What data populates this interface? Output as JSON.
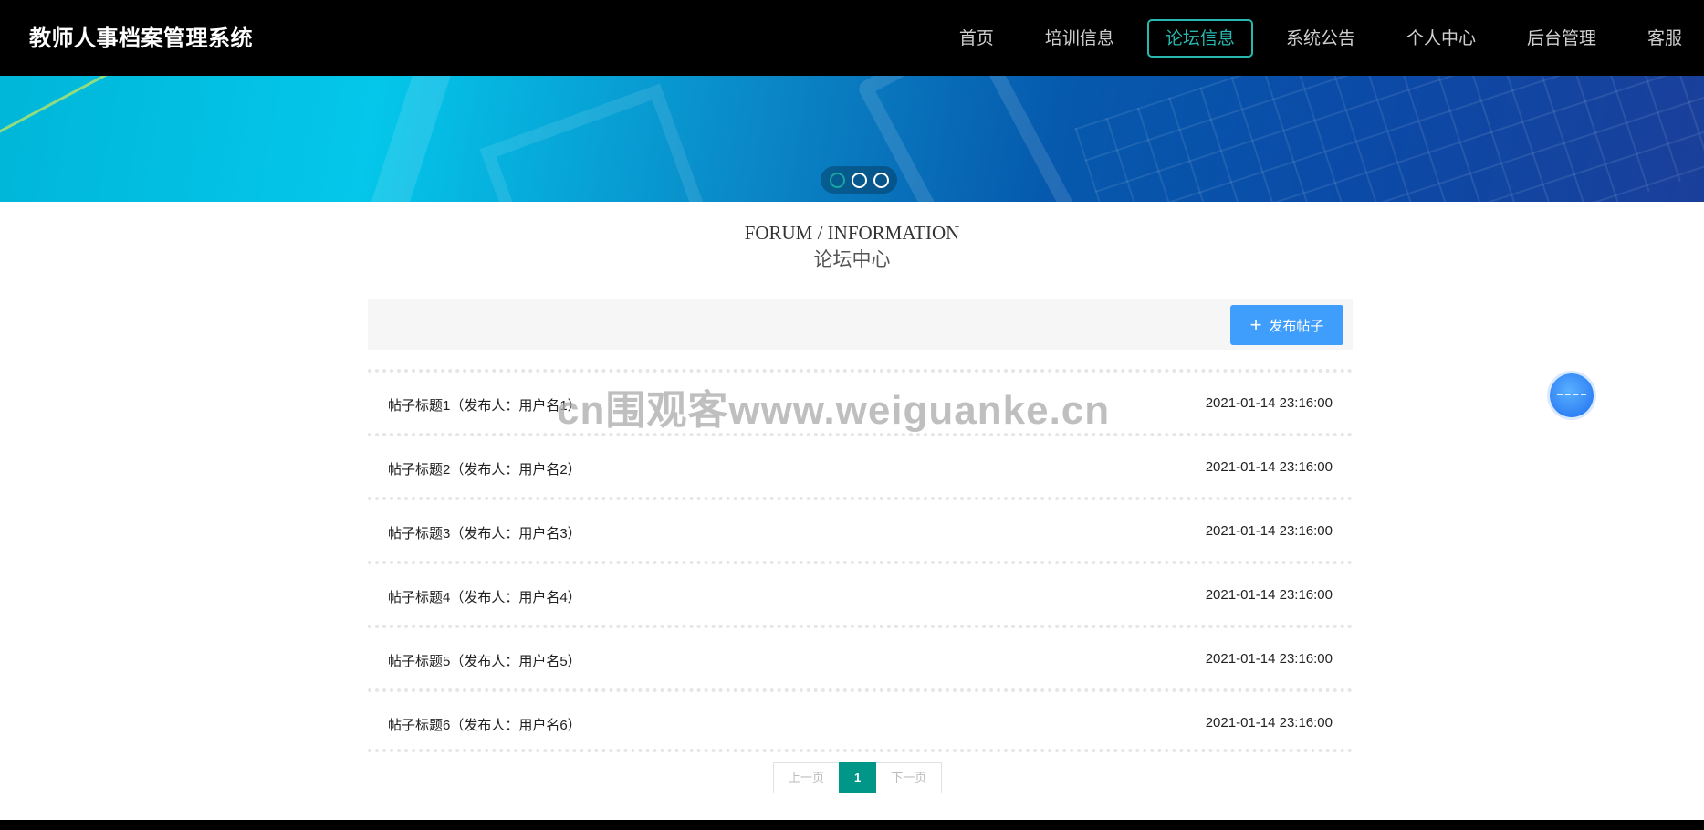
{
  "brand": "教师人事档案管理系统",
  "nav": {
    "items": [
      "首页",
      "培训信息",
      "论坛信息",
      "系统公告",
      "个人中心",
      "后台管理",
      "客服"
    ],
    "active": "论坛信息"
  },
  "banner": {
    "slides": 3,
    "active_slide": 1
  },
  "section": {
    "title": "FORUM / INFORMATION",
    "subtitle": "论坛中心"
  },
  "toolbar": {
    "post_label": "发布帖子",
    "post_icon": "plus-icon"
  },
  "posts": [
    {
      "title": "帖子标题1（发布人：用户名1）",
      "time": "2021-01-14 23:16:00"
    },
    {
      "title": "帖子标题2（发布人：用户名2）",
      "time": "2021-01-14 23:16:00"
    },
    {
      "title": "帖子标题3（发布人：用户名3）",
      "time": "2021-01-14 23:16:00"
    },
    {
      "title": "帖子标题4（发布人：用户名4）",
      "time": "2021-01-14 23:16:00"
    },
    {
      "title": "帖子标题5（发布人：用户名5）",
      "time": "2021-01-14 23:16:00"
    },
    {
      "title": "帖子标题6（发布人：用户名6）",
      "time": "2021-01-14 23:16:00"
    }
  ],
  "pager": {
    "prev": "上一页",
    "current": "1",
    "next": "下一页"
  },
  "watermark": "cn围观客www.weiguanke.cn",
  "colors": {
    "accent": "#29b8b0",
    "primary_button": "#3f9efc",
    "pager_active": "#009688",
    "topbar": "#000000"
  }
}
